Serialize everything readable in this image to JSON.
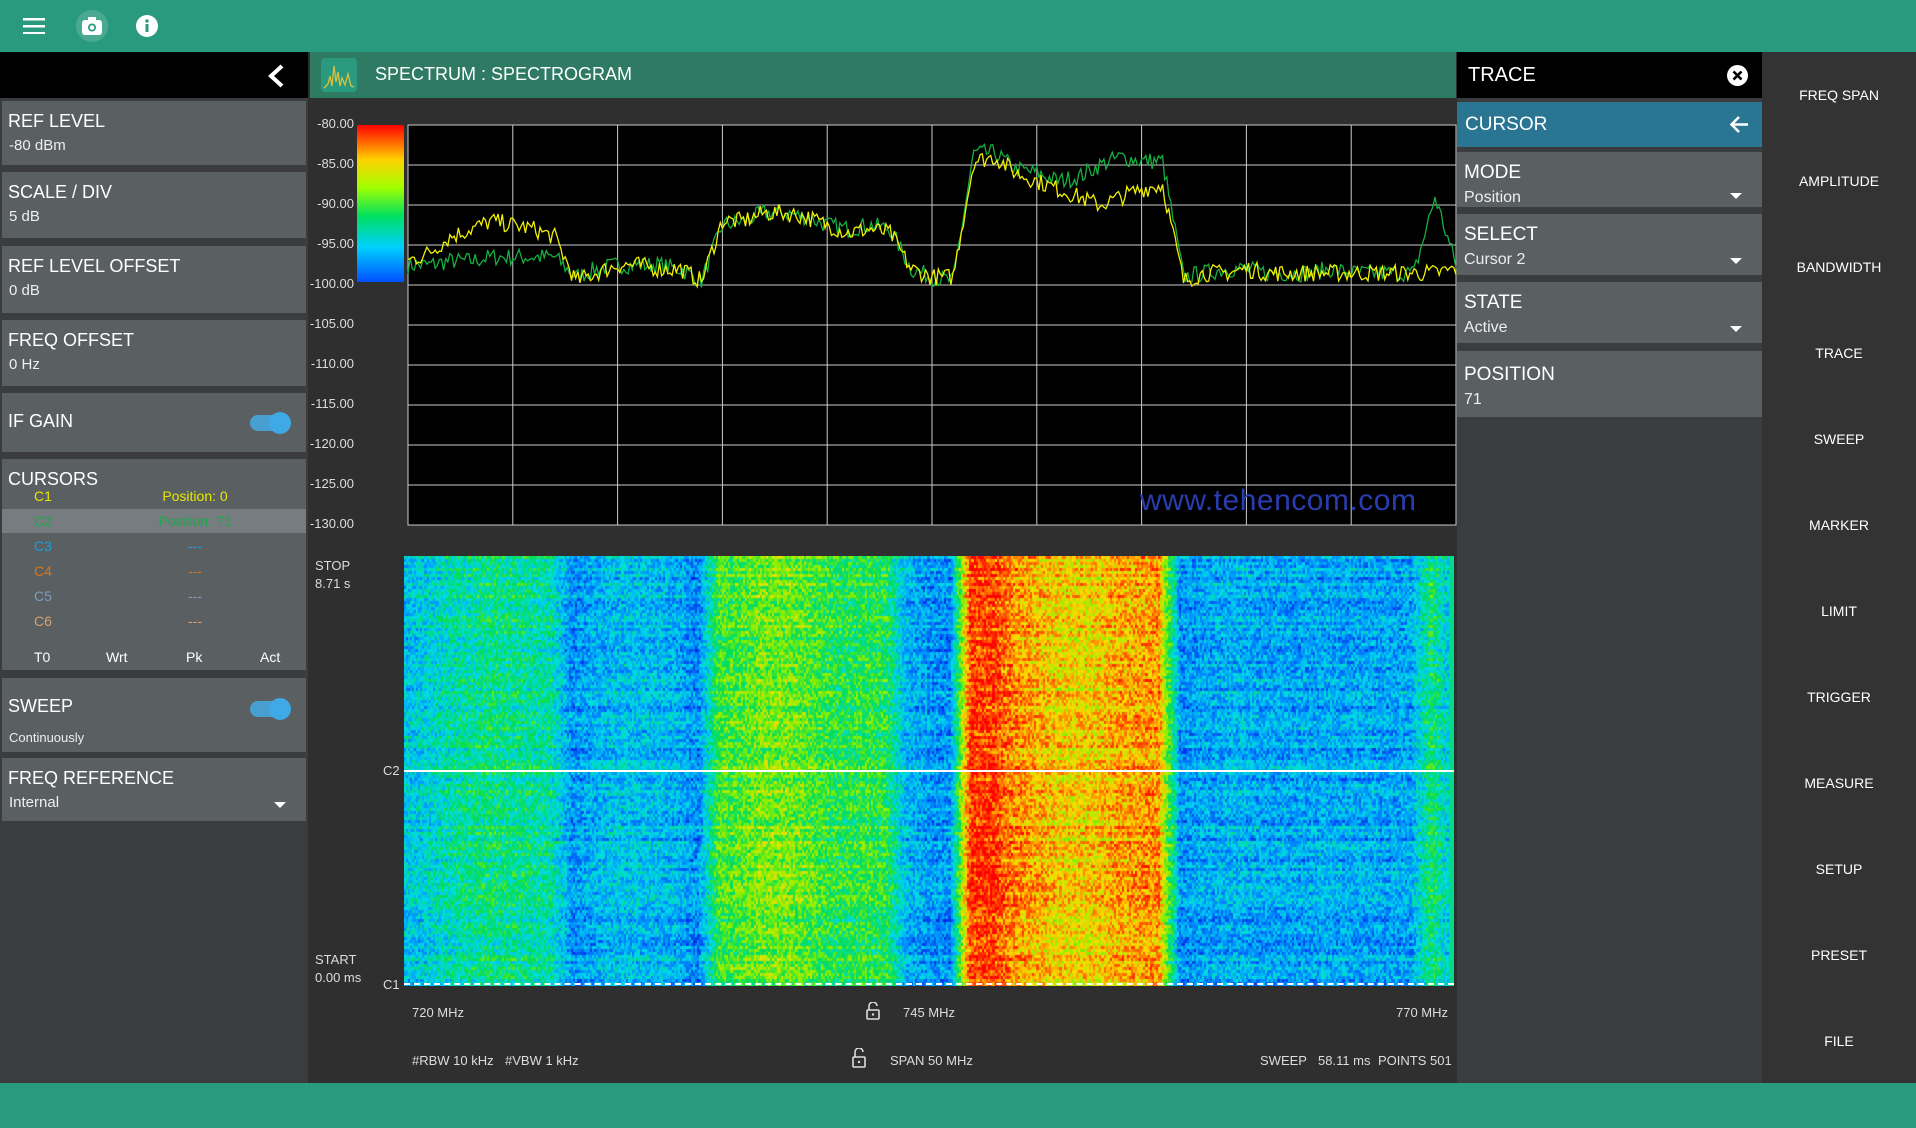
{
  "topbar": {
    "icons": [
      "menu-icon",
      "camera-icon",
      "info-icon"
    ]
  },
  "left_panel": {
    "items": [
      {
        "label": "REF LEVEL",
        "value": "-80 dBm"
      },
      {
        "label": "SCALE / DIV",
        "value": "5 dB"
      },
      {
        "label": "REF LEVEL OFFSET",
        "value": "0 dB"
      },
      {
        "label": "FREQ OFFSET",
        "value": "0 Hz"
      }
    ],
    "if_gain": {
      "label": "IF GAIN",
      "on": true
    },
    "cursors": {
      "title": "CURSORS",
      "rows": [
        {
          "name": "C1",
          "value": "Position: 0",
          "color": "#e8e800"
        },
        {
          "name": "C2",
          "value": "Position: 71",
          "color": "#1aaa4a"
        },
        {
          "name": "C3",
          "value": "---",
          "color": "#1a9fd8"
        },
        {
          "name": "C4",
          "value": "---",
          "color": "#d8761a"
        },
        {
          "name": "C5",
          "value": "---",
          "color": "#7d9cc0"
        },
        {
          "name": "C6",
          "value": "---",
          "color": "#d8a070"
        }
      ],
      "selected": 1,
      "footer": [
        "T0",
        "Wrt",
        "Pk",
        "Act"
      ]
    },
    "sweep": {
      "label": "SWEEP",
      "value": "Continuously",
      "on": true
    },
    "freq_reference": {
      "label": "FREQ REFERENCE",
      "value": "Internal"
    }
  },
  "main": {
    "title": "SPECTRUM : SPECTROGRAM",
    "watermark": "www.tehencom.com",
    "spectrogram": {
      "stop_label": "STOP",
      "stop_value": "8.71 s",
      "start_label": "START",
      "start_value": "0.00 ms",
      "cursor_labels": [
        "C2",
        "C1"
      ]
    },
    "freq_labels": {
      "start": "720 MHz",
      "center": "745 MHz",
      "stop": "770 MHz"
    },
    "footer": {
      "rbw": "#RBW 10 kHz",
      "vbw": "#VBW 1 kHz",
      "span": "SPAN 50 MHz",
      "sweep": "SWEEP",
      "sweep_time": "58.11 ms",
      "points": "POINTS 501"
    }
  },
  "chart_data": {
    "type": "line",
    "xlim": [
      720,
      770
    ],
    "ylim": [
      -130,
      -80
    ],
    "grid": true,
    "y_ticks": [
      "-80.00",
      "-85.00",
      "-90.00",
      "-95.00",
      "-100.00",
      "-105.00",
      "-110.00",
      "-115.00",
      "-120.00",
      "-125.00",
      "-130.00"
    ],
    "colorbar_range": [
      -100,
      -80
    ],
    "x": [
      720,
      721,
      722,
      723,
      724,
      725,
      726,
      727,
      728,
      729,
      730,
      731,
      732,
      733,
      734,
      735,
      736,
      737,
      738,
      739,
      740,
      741,
      742,
      743,
      744,
      745,
      746,
      747,
      748,
      749,
      750,
      751,
      752,
      753,
      754,
      755,
      756,
      757,
      758,
      759,
      760,
      761,
      762,
      763,
      764,
      765,
      766,
      767,
      768,
      769,
      770
    ],
    "series": [
      {
        "color": "#f0f000",
        "values": [
          -97,
          -96,
          -94,
          -93,
          -92,
          -92.5,
          -93,
          -94,
          -99.5,
          -98.5,
          -97.5,
          -97.5,
          -98,
          -98,
          -99.5,
          -92,
          -92,
          -91,
          -91,
          -91.5,
          -92.5,
          -93.5,
          -93,
          -93.5,
          -98,
          -99,
          -99,
          -84.5,
          -84,
          -86,
          -87,
          -88,
          -89,
          -90,
          -89,
          -88,
          -87.5,
          -99.5,
          -98.5,
          -98.5,
          -98,
          -98.5,
          -98.5,
          -98.5,
          -98.5,
          -98.5,
          -98.5,
          -98.5,
          -98.5,
          -98.5,
          -98
        ]
      },
      {
        "color": "#14b040",
        "values": [
          -97.5,
          -97.5,
          -97,
          -97,
          -96.5,
          -96.5,
          -96.5,
          -96.5,
          -99,
          -98,
          -97.5,
          -97.5,
          -97.5,
          -98,
          -99.5,
          -92.5,
          -92,
          -91,
          -91,
          -91.5,
          -92.5,
          -93,
          -92.5,
          -93,
          -98,
          -99,
          -99.5,
          -83.5,
          -83.5,
          -85.5,
          -86,
          -87,
          -86.5,
          -85,
          -84,
          -84.5,
          -84.5,
          -99,
          -98.5,
          -98,
          -98,
          -98.5,
          -98.5,
          -98.5,
          -98,
          -98.5,
          -98.5,
          -98.5,
          -98.5,
          -89,
          -97.5
        ]
      }
    ]
  },
  "trace_panel": {
    "title": "TRACE",
    "sub_title": "CURSOR",
    "fields": [
      {
        "label": "MODE",
        "value": "Position",
        "dropdown": true
      },
      {
        "label": "SELECT",
        "value": "Cursor 2",
        "dropdown": true
      },
      {
        "label": "STATE",
        "value": "Active",
        "dropdown": true
      },
      {
        "label": "POSITION",
        "value": "71",
        "dropdown": false
      }
    ]
  },
  "menu": {
    "items": [
      "FREQ SPAN",
      "AMPLITUDE",
      "BANDWIDTH",
      "TRACE",
      "SWEEP",
      "MARKER",
      "LIMIT",
      "TRIGGER",
      "MEASURE",
      "SETUP",
      "PRESET",
      "FILE"
    ]
  }
}
